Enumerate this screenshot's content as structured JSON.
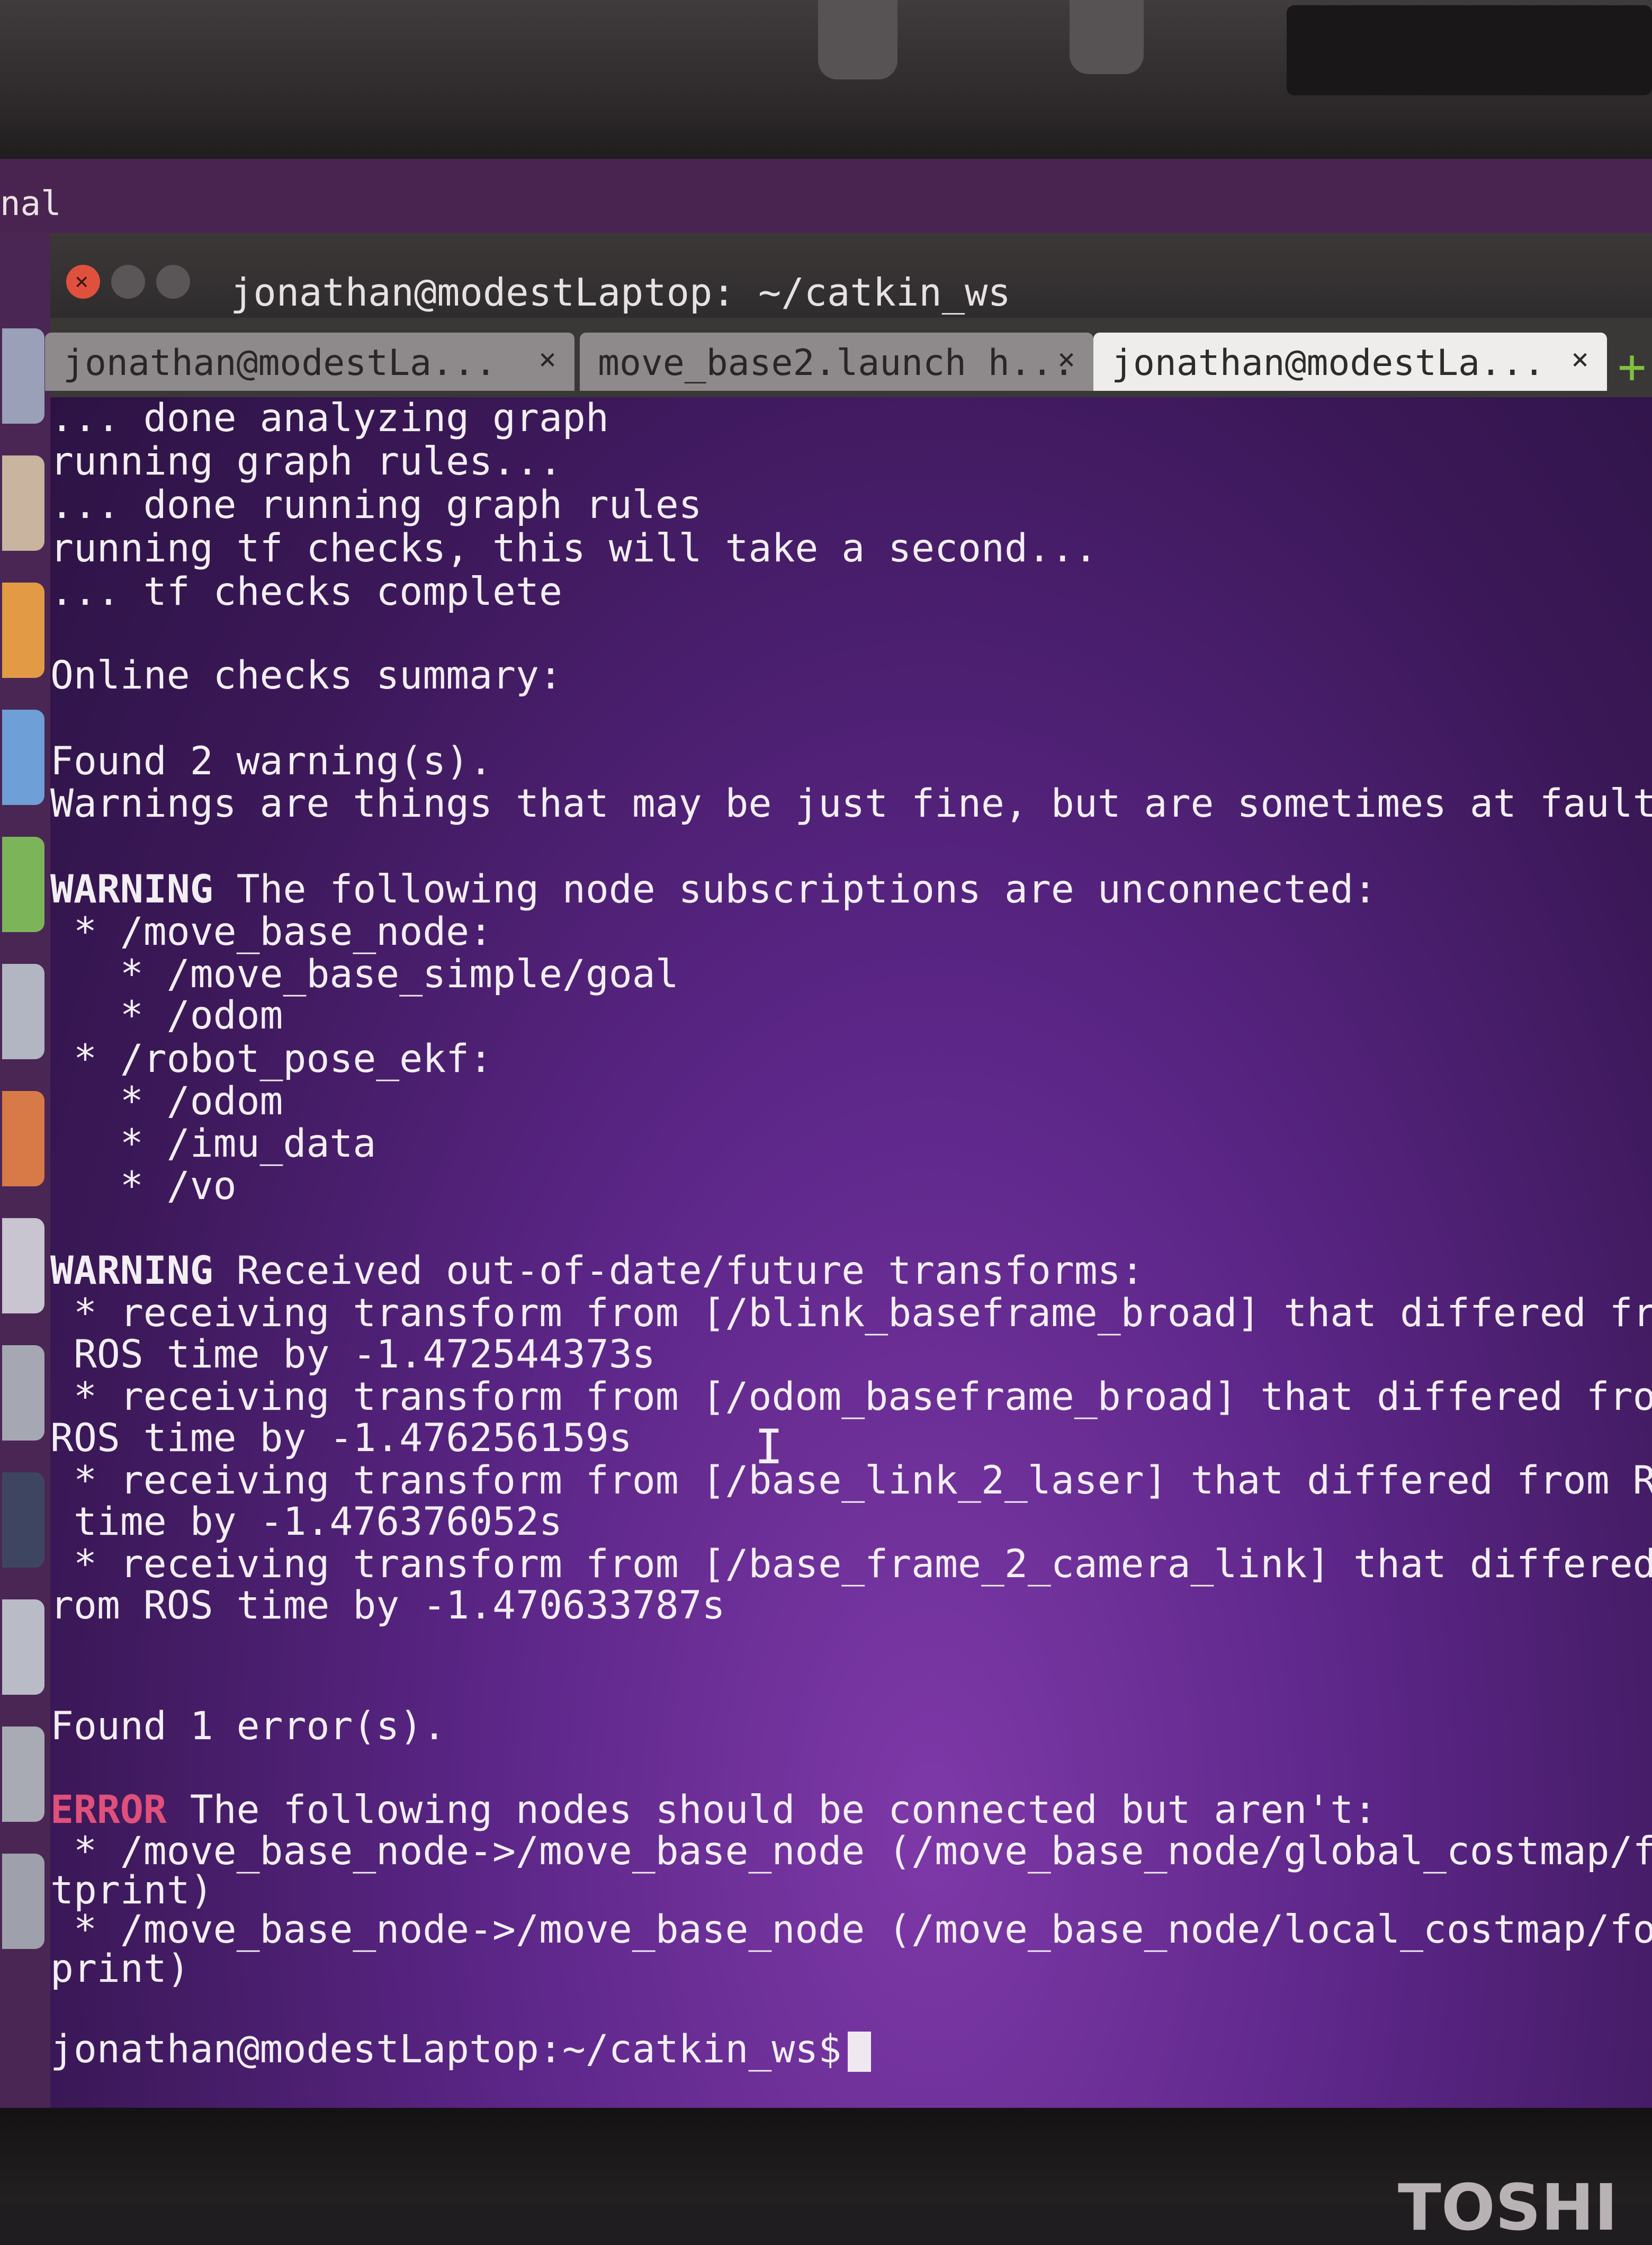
{
  "desktop": {
    "topbar_label": "nal"
  },
  "window": {
    "title": "jonathan@modestLaptop: ~/catkin_ws",
    "close_glyph": "×",
    "tabs": [
      {
        "label": "jonathan@modestLa...",
        "close": "×",
        "active": false
      },
      {
        "label": "move_base2.launch h...",
        "close": "×",
        "active": false
      },
      {
        "label": "jonathan@modestLa...",
        "close": "×",
        "active": true
      }
    ],
    "new_tab": "+"
  },
  "terminal": {
    "lines": [
      "... done analyzing graph",
      "running graph rules...",
      "... done running graph rules",
      "running tf checks, this will take a second...",
      "... tf checks complete",
      "",
      "Online checks summary:",
      "",
      "Found 2 warning(s).",
      "Warnings are things that may be just fine, but are sometimes at fault",
      "",
      "The following node subscriptions are unconnected:",
      " * /move_base_node:",
      "   * /move_base_simple/goal",
      "   * /odom",
      " * /robot_pose_ekf:",
      "   * /odom",
      "   * /imu_data",
      "   * /vo",
      "",
      "Received out-of-date/future transforms:",
      " * receiving transform from [/blink_baseframe_broad] that differed from",
      " ROS time by -1.472544373s",
      " * receiving transform from [/odom_baseframe_broad] that differed from",
      "ROS time by -1.476256159s",
      " * receiving transform from [/base_link_2_laser] that differed from ROS",
      " time by -1.476376052s",
      " * receiving transform from [/base_frame_2_camera_link] that differed f",
      "rom ROS time by -1.470633787s",
      "",
      "",
      "Found 1 error(s).",
      "",
      "The following nodes should be connected but aren't:",
      " * /move_base_node->/move_base_node (/move_base_node/global_costmap/foo",
      "tprint)",
      " * /move_base_node->/move_base_node (/move_base_node/local_costmap/foot",
      "print)",
      ""
    ],
    "warning_label": "WARNING",
    "error_label": "ERROR",
    "prompt": "jonathan@modestLaptop:~/catkin_ws$",
    "ibeam": "I"
  },
  "bezel": {
    "brand": "TOSHI"
  },
  "colors": {
    "error": "#e0507a",
    "terminal_text": "#f2eef2",
    "background": "#5c2688"
  }
}
